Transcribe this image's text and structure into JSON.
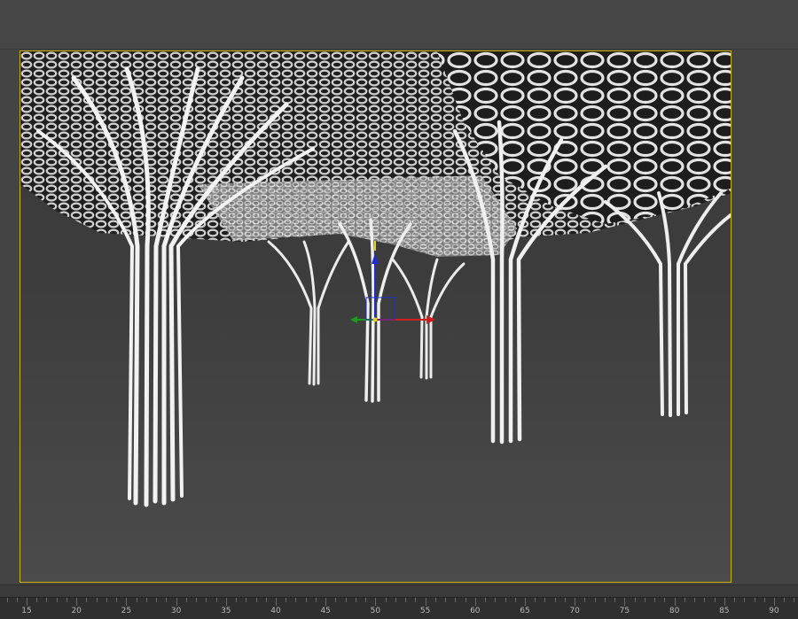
{
  "viewport": {
    "scene": "tree-column-canopy",
    "border_color": "#c8b400",
    "background_color": "#3c3c3c",
    "gizmo": {
      "x_axis_color": "#d01e1e",
      "y_axis_color": "#1e9a1e",
      "z_axis_color": "#1e2ed0",
      "center_color": "#e0d020"
    }
  },
  "timeline": {
    "ruler_labels": [
      "15",
      "20",
      "25",
      "30",
      "35",
      "40",
      "45",
      "50",
      "55",
      "60",
      "65",
      "70",
      "75",
      "80",
      "85",
      "90"
    ]
  }
}
